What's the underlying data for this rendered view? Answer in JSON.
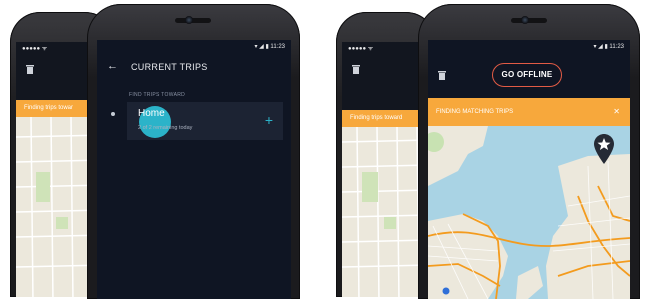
{
  "phone_left_back": {
    "status_left": "●●●●● ᯤ",
    "banner": "Finding trips towar"
  },
  "phone_left_front": {
    "status_time": "11:23",
    "header_title": "CURRENT TRIPS",
    "section_label": "FIND TRIPS TOWARD",
    "item_title": "Home",
    "item_sub": "2 of 2 remaining today"
  },
  "phone_right_back": {
    "status_left": "●●●●● ᯤ",
    "banner": "Finding trips toward"
  },
  "phone_right_front": {
    "status_time": "11:23",
    "go_offline_label": "GO OFFLINE",
    "banner": "FINDING MATCHING TRIPS",
    "banner_close": "✕"
  },
  "colors": {
    "accent": "#2bb3c9",
    "banner_orange": "#f7a83c",
    "dark_bg": "#0f1523",
    "card": "#1c2333",
    "water": "#a9d3e4",
    "land": "#ece8dc",
    "route": "#f39b1e"
  }
}
